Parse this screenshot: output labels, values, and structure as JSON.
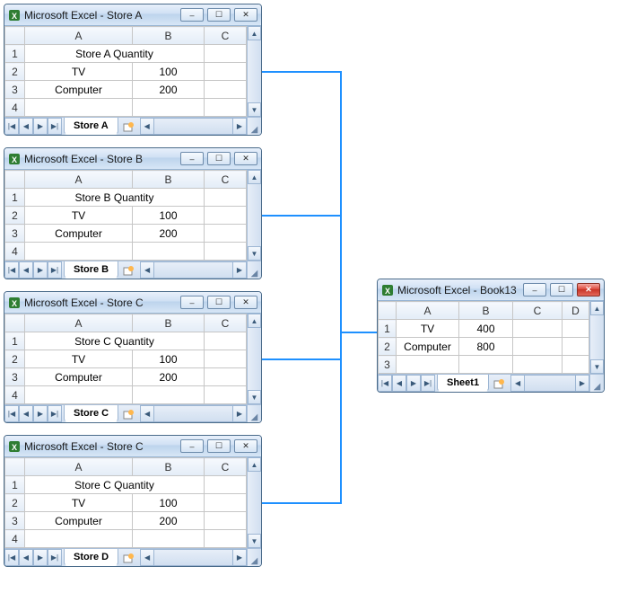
{
  "windows": [
    {
      "title": "Microsoft Excel - Store A",
      "tab": "Store A",
      "header": "Store A Quantity",
      "rows": [
        [
          "TV",
          "100"
        ],
        [
          "Computer",
          "200"
        ]
      ],
      "columns": [
        "A",
        "B",
        "C"
      ],
      "rownums": [
        "1",
        "2",
        "3",
        "4"
      ]
    },
    {
      "title": "Microsoft Excel - Store B",
      "tab": "Store B",
      "header": "Store B Quantity",
      "rows": [
        [
          "TV",
          "100"
        ],
        [
          "Computer",
          "200"
        ]
      ],
      "columns": [
        "A",
        "B",
        "C"
      ],
      "rownums": [
        "1",
        "2",
        "3",
        "4"
      ]
    },
    {
      "title": "Microsoft Excel - Store C",
      "tab": "Store C",
      "header": "Store C Quantity",
      "rows": [
        [
          "TV",
          "100"
        ],
        [
          "Computer",
          "200"
        ]
      ],
      "columns": [
        "A",
        "B",
        "C"
      ],
      "rownums": [
        "1",
        "2",
        "3",
        "4"
      ]
    },
    {
      "title": "Microsoft Excel - Store C",
      "tab": "Store D",
      "header": "Store C Quantity",
      "rows": [
        [
          "TV",
          "100"
        ],
        [
          "Computer",
          "200"
        ]
      ],
      "columns": [
        "A",
        "B",
        "C"
      ],
      "rownums": [
        "1",
        "2",
        "3",
        "4"
      ]
    }
  ],
  "result": {
    "title": "Microsoft Excel - Book13",
    "tab": "Sheet1",
    "columns": [
      "A",
      "B",
      "C",
      "D"
    ],
    "rownums": [
      "1",
      "2",
      "3"
    ],
    "rows": [
      [
        "TV",
        "400"
      ],
      [
        "Computer",
        "800"
      ]
    ]
  },
  "glyphs": {
    "min": "–",
    "max": "☐",
    "close": "✕",
    "up": "▲",
    "down": "▼",
    "left": "◀",
    "right": "▶",
    "first": "|◀",
    "last": "▶|"
  }
}
